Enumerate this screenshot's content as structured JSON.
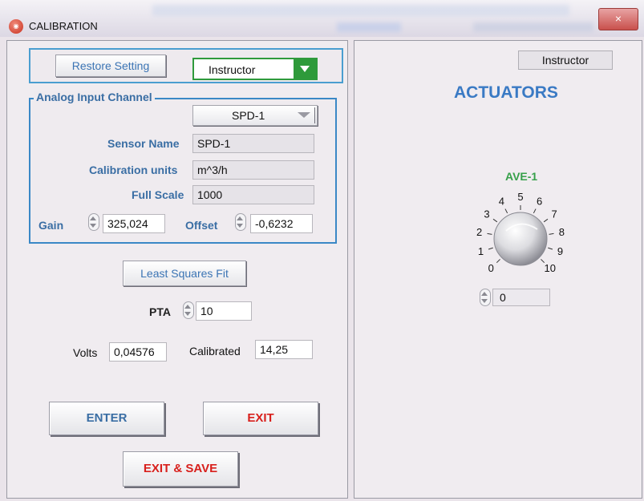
{
  "window": {
    "title": "CALIBRATION",
    "close_label": "×"
  },
  "left": {
    "restore_button": "Restore Setting",
    "user_select": "Instructor",
    "analog_group_title": "Analog Input Channel",
    "channel_select": "SPD-1",
    "sensor_name_label": "Sensor Name",
    "sensor_name_value": "SPD-1",
    "calibration_units_label": "Calibration units",
    "calibration_units_value": "m^3/h",
    "full_scale_label": "Full Scale",
    "full_scale_value": "1000",
    "gain_label": "Gain",
    "gain_value": "325,024",
    "offset_label": "Offset",
    "offset_value": "-0,6232",
    "least_squares_button": "Least Squares Fit",
    "pta_label": "PTA",
    "pta_value": "10",
    "volts_label": "Volts",
    "volts_value": "0,04576",
    "calibrated_label": "Calibrated",
    "calibrated_value": "14,25",
    "enter_button": "ENTER",
    "exit_button": "EXIT",
    "exit_save_button": "EXIT & SAVE"
  },
  "right": {
    "user_indicator": "Instructor",
    "title": "ACTUATORS",
    "knob": {
      "label": "AVE-1",
      "ticks": [
        "0",
        "1",
        "2",
        "3",
        "4",
        "5",
        "6",
        "7",
        "8",
        "9",
        "10"
      ],
      "value": "0"
    }
  },
  "colors": {
    "label_blue": "#3a6ea4",
    "title_blue": "#3a7ac4",
    "knob_green": "#36a04a",
    "exit_red": "#d8201c",
    "select_green": "#2e9a3a"
  }
}
